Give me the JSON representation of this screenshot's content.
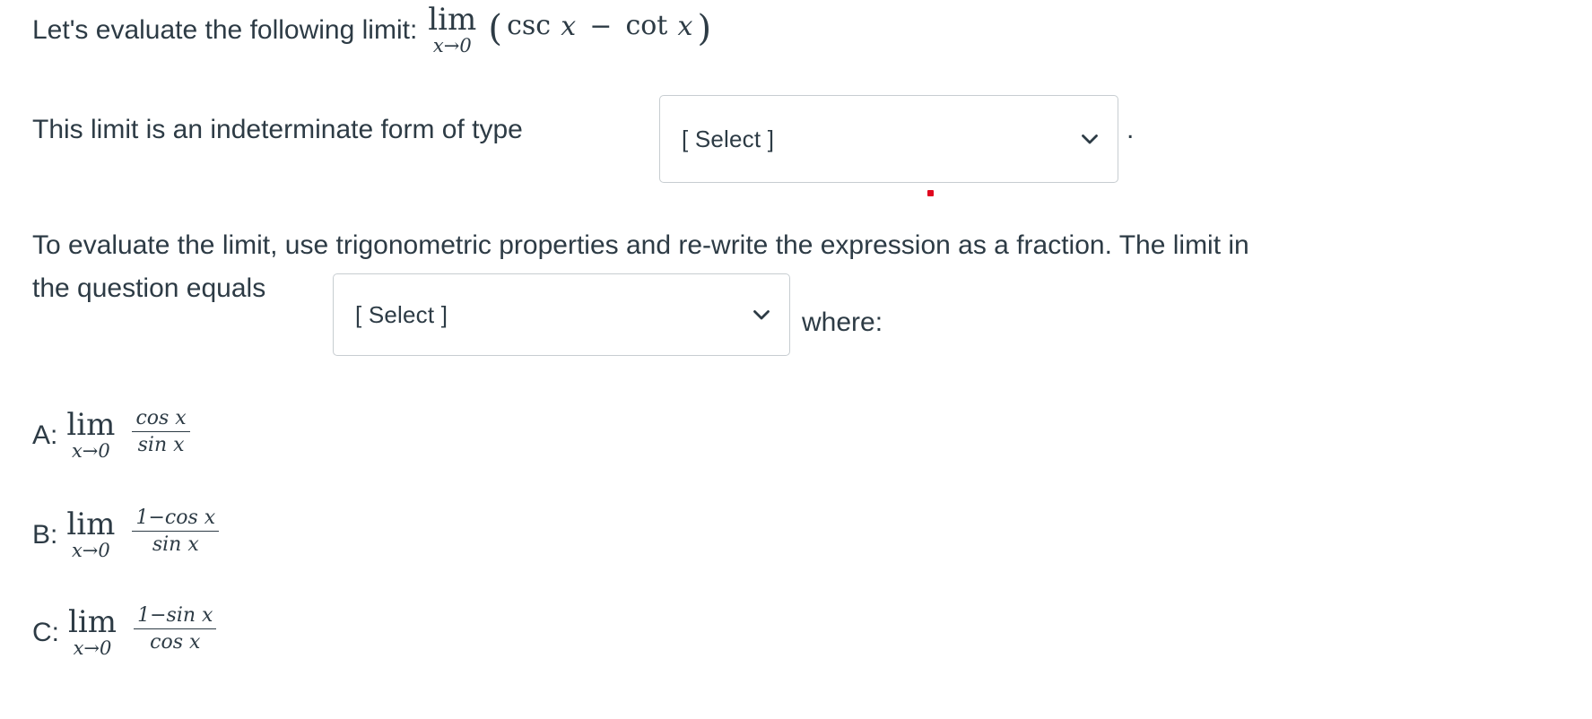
{
  "question": {
    "line1": {
      "text_before": "Let's evaluate the following limit:",
      "math": {
        "lim_label": "lim",
        "lim_sub": "x→0",
        "open_paren": "(",
        "fn1": "csc",
        "var1": "x",
        "minus": "−",
        "fn2": "cot",
        "var2": "x",
        "close_paren": ")"
      }
    },
    "line2": {
      "text_before": "This limit is an indeterminate form of type",
      "select_value": "[ Select ]",
      "text_after": "."
    },
    "line3": {
      "text": "To evaluate the limit, use trigonometric properties and re-write the expression as a fraction. The limit in"
    },
    "line4": {
      "text_before": "the question equals",
      "select_value": "[ Select ]",
      "text_after": "where:"
    }
  },
  "choices": [
    {
      "label": "A:",
      "lim_label": "lim",
      "lim_sub": "x→0",
      "numerator": "cos x",
      "denominator": "sin x"
    },
    {
      "label": "B:",
      "lim_label": "lim",
      "lim_sub": "x→0",
      "numerator": "1−cos x",
      "denominator": "sin x"
    },
    {
      "label": "C:",
      "lim_label": "lim",
      "lim_sub": "x→0",
      "numerator": "1−sin x",
      "denominator": "cos x"
    }
  ],
  "icons": {
    "chevron_down": "chevron-down-icon",
    "validation_marker": "red-dot-marker"
  },
  "colors": {
    "text": "#2d3b45",
    "select_border": "#c7cdd1",
    "validation_dot": "#e0061f",
    "background": "#ffffff"
  }
}
